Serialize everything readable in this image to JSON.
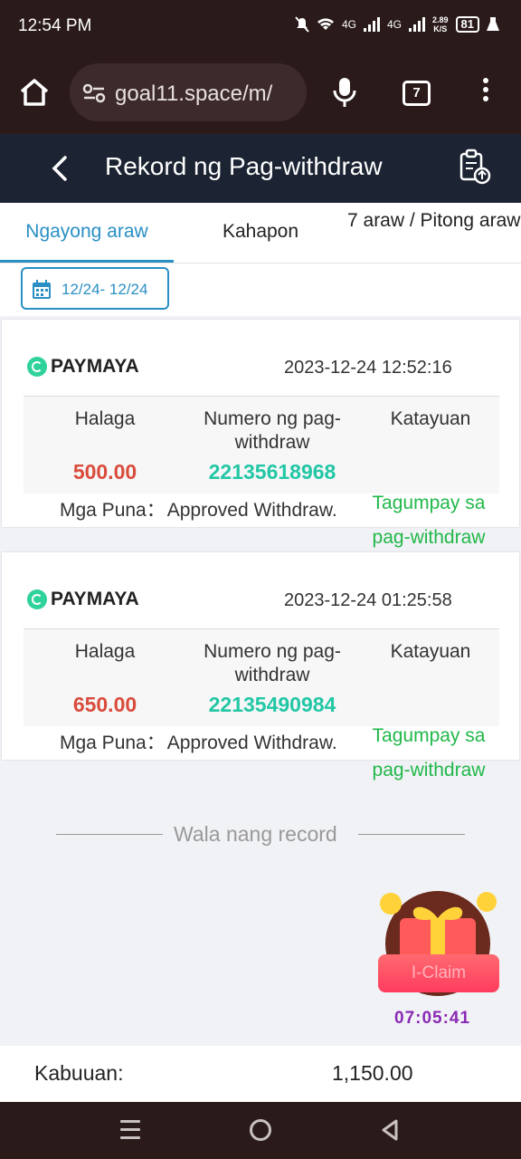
{
  "status_bar": {
    "time": "12:54 PM",
    "net1": "4G",
    "net2": "4G",
    "speed_value": "2.89",
    "speed_unit": "K/S",
    "battery": "81"
  },
  "browser": {
    "url": "goal11.space/m/",
    "tab_count": "7"
  },
  "header": {
    "title": "Rekord ng Pag-withdraw"
  },
  "tabs": [
    {
      "label": "Ngayong araw",
      "active": true
    },
    {
      "label": "Kahapon",
      "active": false
    },
    {
      "label": "7 araw / Pitong araw",
      "active": false
    }
  ],
  "filter": {
    "date_range": "12/24- 12/24"
  },
  "columns": {
    "amount": "Halaga",
    "number": "Numero ng pag-withdraw",
    "status": "Katayuan",
    "remark_label": "Mga Puna："
  },
  "records": [
    {
      "method": "PAYMAYA",
      "datetime": "2023-12-24 12:52:16",
      "amount": "500.00",
      "number": "22135618968",
      "status": "Tagumpay sa pag-withdraw",
      "remark": "Approved Withdraw."
    },
    {
      "method": "PAYMAYA",
      "datetime": "2023-12-24 01:25:58",
      "amount": "650.00",
      "number": "22135490984",
      "status": "Tagumpay sa pag-withdraw",
      "remark": "Approved Withdraw."
    }
  ],
  "empty_note": "Wala nang record",
  "promo": {
    "claim_label": "I-Claim",
    "timer": "07:05:41"
  },
  "total": {
    "label": "Kabuuan:",
    "value": "1,150.00"
  },
  "colors": {
    "accent": "#2a8fc4",
    "header_bg": "#1c2433",
    "amount": "#d94b3b",
    "number": "#23c7a5",
    "success": "#21b84a"
  }
}
